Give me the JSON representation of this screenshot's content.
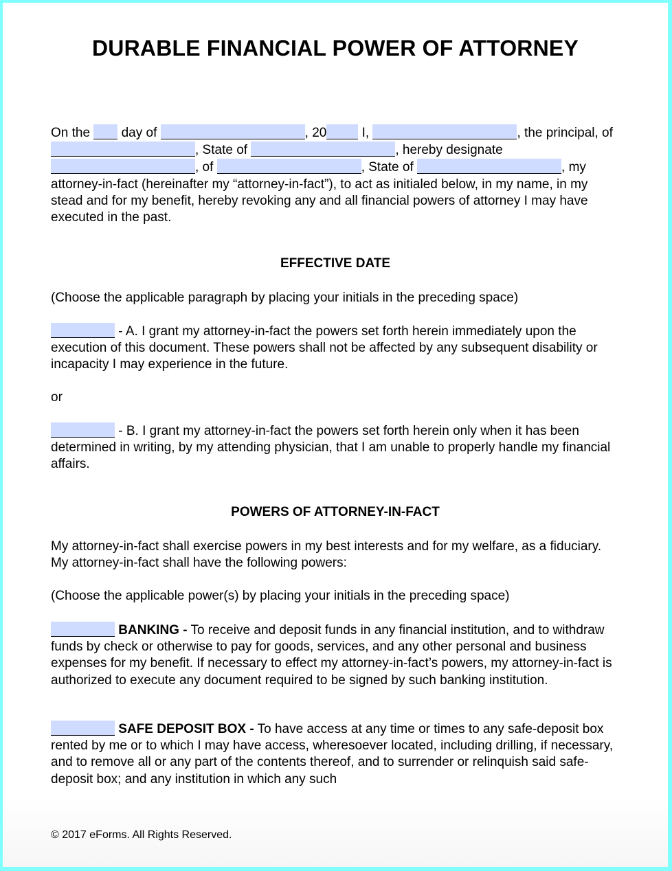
{
  "document": {
    "title": "DURABLE FINANCIAL POWER OF ATTORNEY",
    "intro": {
      "t1": "On the ",
      "t2": " day of ",
      "t3": ", 20",
      "t4": " I, ",
      "t5": ", the principal, of ",
      "t6": ", State of ",
      "t7": ", hereby designate ",
      "t8": ", of ",
      "t9": ", State of ",
      "t10": ", my attorney-in-fact (hereinafter my “attorney-in-fact”), to act as initialed below, in my name, in my stead and for my benefit, hereby revoking any and all financial powers of attorney I may have executed in the past."
    },
    "effective_date": {
      "heading": "EFFECTIVE DATE",
      "instruction": "(Choose the applicable paragraph by placing your initials in the preceding space)",
      "option_a": " - A. I grant my attorney-in-fact the powers set forth herein immediately upon the execution of this document. These powers shall not be affected by any subsequent disability or incapacity I may experience in the future.",
      "or": "or",
      "option_b": " - B. I grant my attorney-in-fact the powers set forth herein only when it has been determined in writing, by my attending physician, that I am unable to properly handle my financial affairs."
    },
    "powers": {
      "heading": "POWERS OF ATTORNEY-IN-FACT",
      "intro": "My attorney-in-fact shall exercise powers in my best interests and for my welfare, as a fiduciary. My attorney-in-fact shall have the following powers:",
      "instruction": "(Choose the applicable power(s) by placing your initials in the preceding space)",
      "banking_label": "BANKING -",
      "banking_text": " To receive and deposit funds in any financial institution, and to withdraw funds by check or otherwise to pay for goods, services, and any other personal and business expenses for my benefit.  If necessary to effect my attorney-in-fact’s powers, my attorney-in-fact is authorized to execute any document required to be signed by such banking institution.",
      "safe_label": "SAFE DEPOSIT BOX -",
      "safe_text": " To have access at any time or times to any safe-deposit box rented by me or to which I may have access, wheresoever located, including drilling, if necessary, and to remove all or any part of the contents thereof, and to surrender or relinquish said safe-deposit box; and any institution in which any such"
    },
    "footer": "© 2017 eForms. All Rights Reserved."
  },
  "fields": {
    "day": "",
    "month": "",
    "year_suffix": "",
    "principal_name": "",
    "principal_city": "",
    "principal_state": "",
    "agent_name": "",
    "agent_city": "",
    "agent_state": "",
    "initials_option_a": "",
    "initials_option_b": "",
    "initials_banking": "",
    "initials_safe_deposit": ""
  },
  "colors": {
    "field_fill": "#d0dcff",
    "frame": "#80ffff"
  }
}
